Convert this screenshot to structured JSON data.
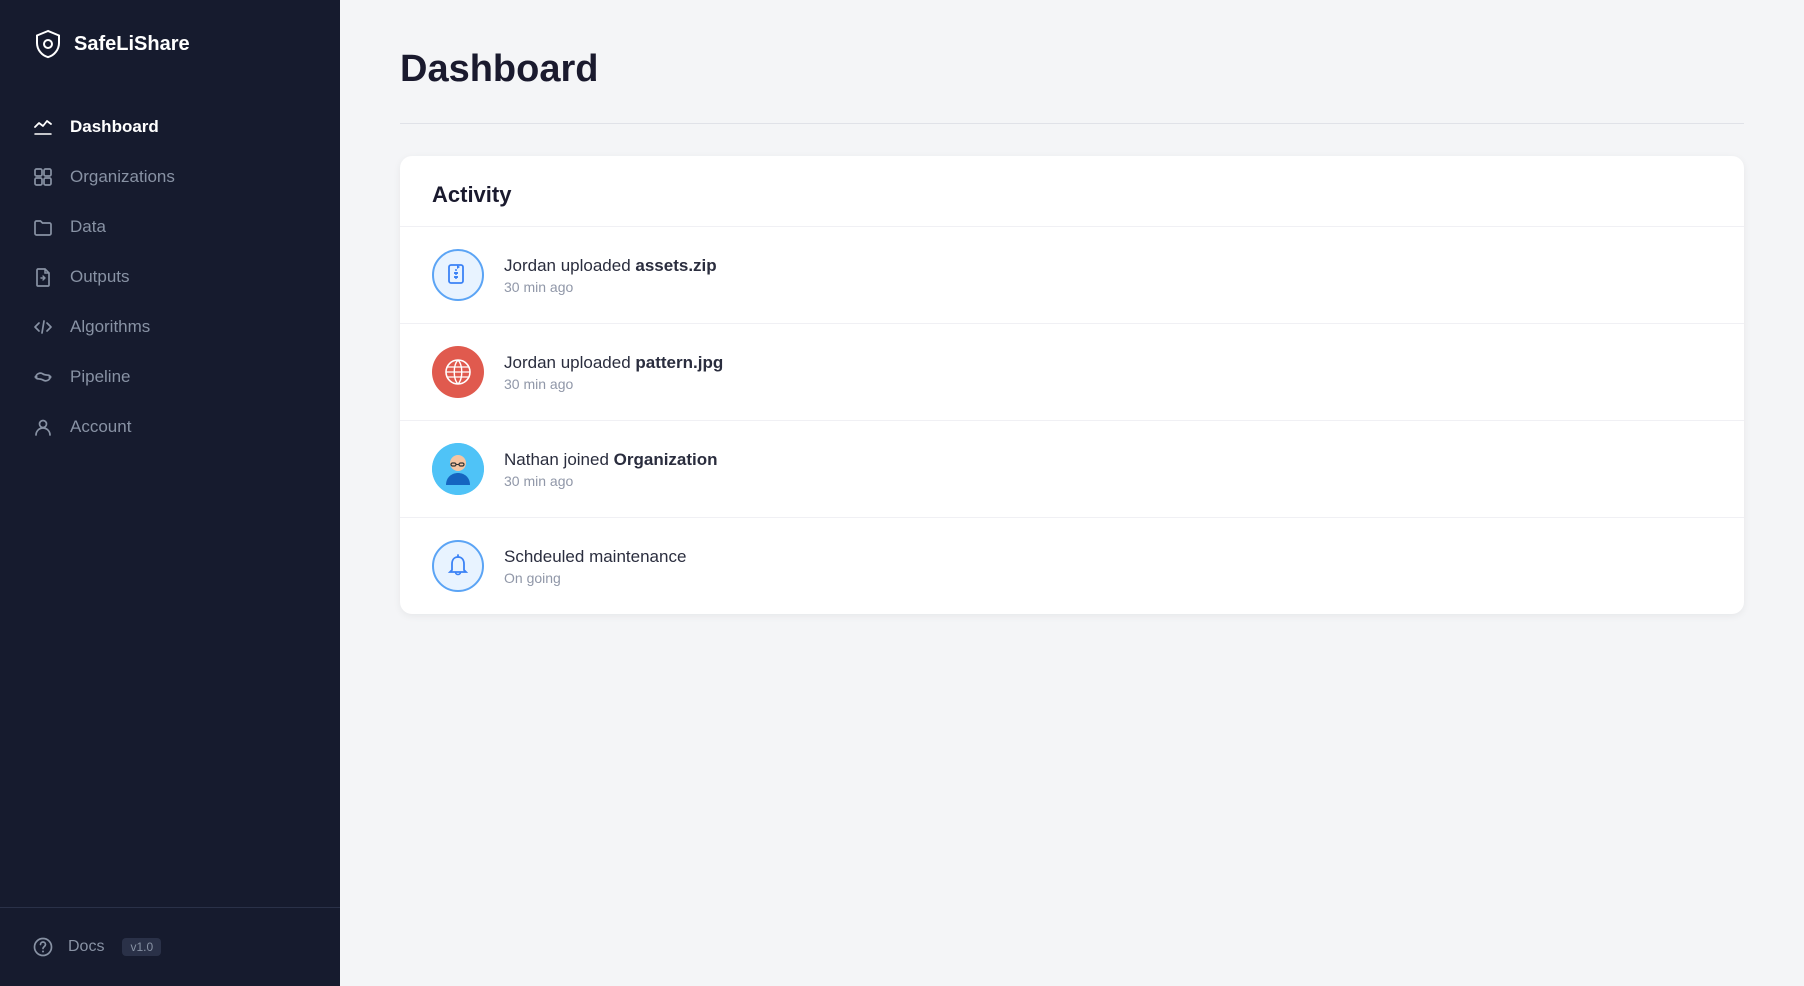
{
  "app": {
    "logo_text": "SafeLiShare",
    "logo_icon": "shield"
  },
  "sidebar": {
    "nav_items": [
      {
        "id": "dashboard",
        "label": "Dashboard",
        "icon": "chart-icon",
        "active": true
      },
      {
        "id": "organizations",
        "label": "Organizations",
        "icon": "grid-icon",
        "active": false
      },
      {
        "id": "data",
        "label": "Data",
        "icon": "folder-icon",
        "active": false
      },
      {
        "id": "outputs",
        "label": "Outputs",
        "icon": "file-out-icon",
        "active": false
      },
      {
        "id": "algorithms",
        "label": "Algorithms",
        "icon": "code-icon",
        "active": false
      },
      {
        "id": "pipeline",
        "label": "Pipeline",
        "icon": "pipeline-icon",
        "active": false
      },
      {
        "id": "account",
        "label": "Account",
        "icon": "user-icon",
        "active": false
      }
    ],
    "footer": {
      "docs_label": "Docs",
      "version": "v1.0",
      "icon": "question-icon"
    }
  },
  "main": {
    "page_title": "Dashboard",
    "activity": {
      "section_title": "Activity",
      "items": [
        {
          "id": "item-1",
          "description_prefix": "Jordan uploaded ",
          "description_bold": "assets.zip",
          "time": "30 min ago",
          "avatar_type": "zip"
        },
        {
          "id": "item-2",
          "description_prefix": "Jordan uploaded ",
          "description_bold": "pattern.jpg",
          "time": "30 min ago",
          "avatar_type": "globe"
        },
        {
          "id": "item-3",
          "description_prefix": "Nathan joined ",
          "description_bold": "Organization",
          "time": "30 min ago",
          "avatar_type": "person"
        },
        {
          "id": "item-4",
          "description_prefix": "Schdeuled maintenance",
          "description_bold": "",
          "time": "On going",
          "avatar_type": "bell"
        }
      ]
    }
  }
}
